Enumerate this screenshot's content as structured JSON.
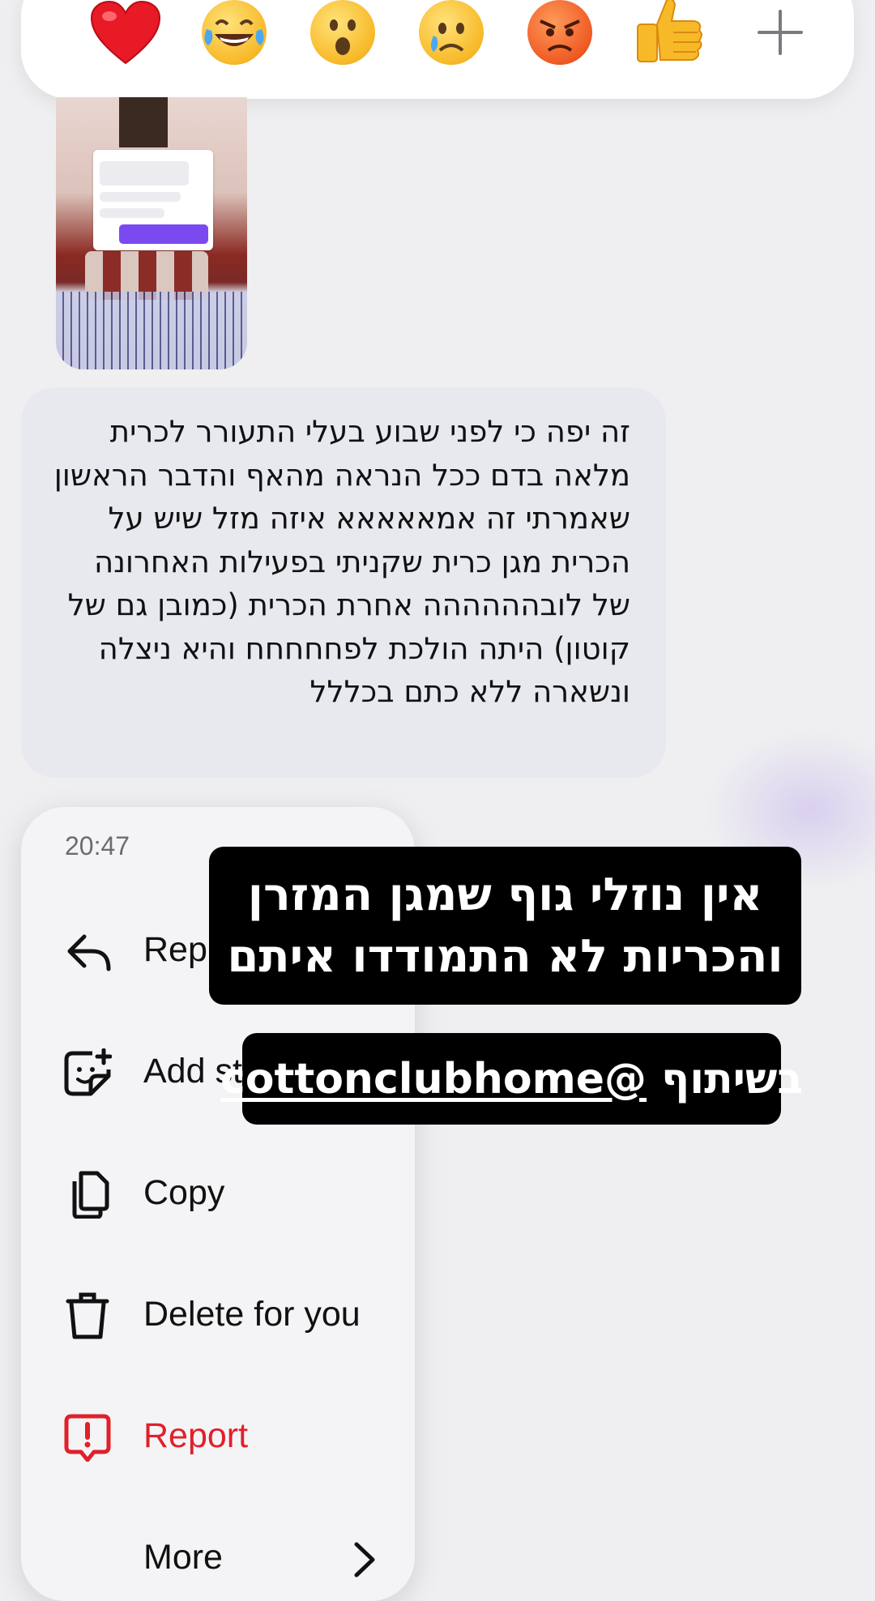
{
  "reactions": [
    {
      "icon": "red-heart-icon",
      "glyph": "❤"
    },
    {
      "icon": "tears-of-joy-icon"
    },
    {
      "icon": "surprised-face-icon"
    },
    {
      "icon": "crying-face-icon"
    },
    {
      "icon": "angry-face-icon"
    },
    {
      "icon": "thumbs-up-icon",
      "glyph": "👍"
    },
    {
      "icon": "add-reaction-icon"
    }
  ],
  "message": {
    "text": "זה יפה כי לפני שבוע בעלי התעורר לכרית מלאה בדם ככל הנראה מהאף והדבר הראשון שאמרתי זה אמאאאאא איזה מזל שיש על הכרית מגן כרית שקניתי בפעילות האחרונה של לובהההההה אחרת הכרית (כמובן גם של קוטון) היתה הולכת לפחחחחח והיא ניצלה ונשארה ללא כתם בכללל"
  },
  "context_menu": {
    "time": "20:47",
    "items": [
      {
        "label": "Reply",
        "icon": "reply-arrow-icon"
      },
      {
        "label": "Add sticker",
        "icon": "add-sticker-icon"
      },
      {
        "label": "Copy",
        "icon": "copy-icon"
      },
      {
        "label": "Delete for you",
        "icon": "trash-icon"
      },
      {
        "label": "Report",
        "icon": "report-icon"
      },
      {
        "label": "More",
        "icon": "chevron-right-icon"
      }
    ]
  },
  "story_overlays": {
    "headline": "אין נוזלי גוף שמגן המזרן והכריות לא התמודדו איתם",
    "partner_prefix": "בשיתוף",
    "partner_handle": "@cottonclubhome"
  },
  "colors": {
    "report_red": "#e0202a",
    "bubble_gray": "#e8e9ee",
    "background": "#efeff1"
  }
}
